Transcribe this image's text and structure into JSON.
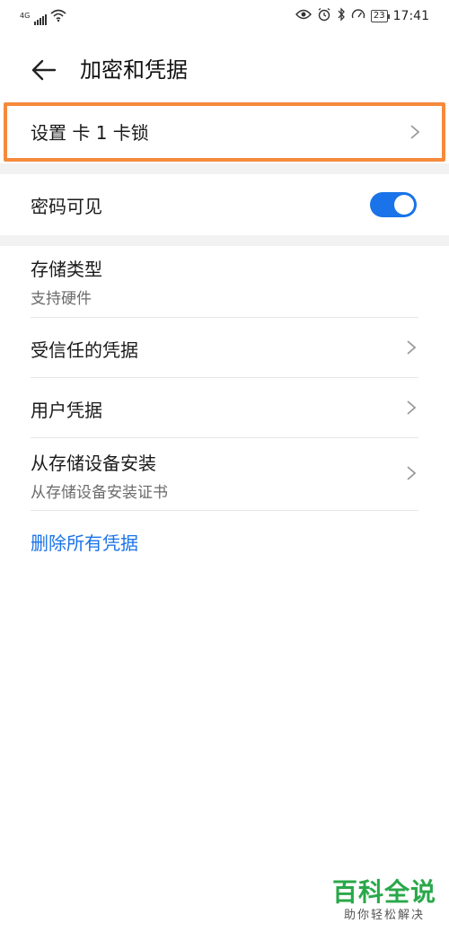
{
  "status_bar": {
    "network": "4G",
    "battery": "23",
    "time": "17:41"
  },
  "header": {
    "title": "加密和凭据"
  },
  "sim_lock": {
    "label": "设置 卡 1 卡锁"
  },
  "password_visible": {
    "label": "密码可见",
    "enabled": true
  },
  "storage_type": {
    "title": "存储类型",
    "subtitle": "支持硬件"
  },
  "trusted_credentials": {
    "title": "受信任的凭据"
  },
  "user_credentials": {
    "title": "用户凭据"
  },
  "install_from_storage": {
    "title": "从存储设备安装",
    "subtitle": "从存储设备安装证书"
  },
  "clear_credentials": {
    "label": "删除所有凭据"
  },
  "watermark": {
    "main": "百科全说",
    "sub": "助你轻松解决"
  },
  "colors": {
    "accent": "#1a73e8",
    "highlight": "#f58a3c",
    "watermark": "#2aa84a"
  }
}
